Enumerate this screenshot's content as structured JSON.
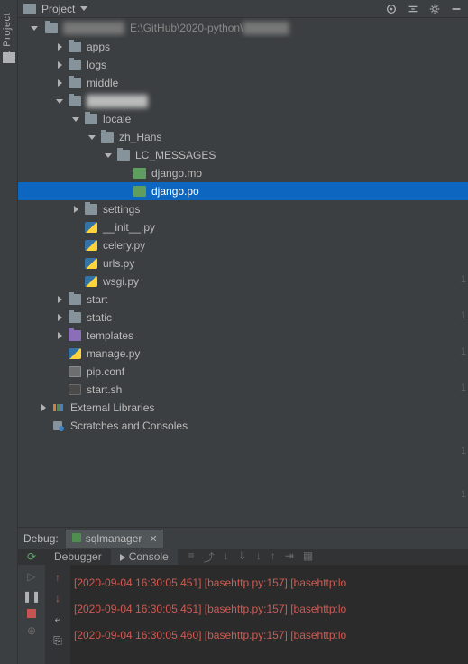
{
  "left_gutter": {
    "label": "1: Project"
  },
  "topbar": {
    "project_label": "Project"
  },
  "path": {
    "text": "E:\\GitHub\\2020-python\\"
  },
  "tree": [
    {
      "indent": 22,
      "chev": "right",
      "icon": "folder",
      "label": "apps"
    },
    {
      "indent": 22,
      "chev": "right",
      "icon": "folder",
      "label": "logs"
    },
    {
      "indent": 22,
      "chev": "right",
      "icon": "folder",
      "label": "middle"
    },
    {
      "indent": 22,
      "chev": "down",
      "icon": "folder",
      "label": "",
      "blur": true
    },
    {
      "indent": 40,
      "chev": "down",
      "icon": "folder",
      "label": "locale"
    },
    {
      "indent": 58,
      "chev": "down",
      "icon": "folder",
      "label": "zh_Hans"
    },
    {
      "indent": 76,
      "chev": "down",
      "icon": "folder",
      "label": "LC_MESSAGES"
    },
    {
      "indent": 94,
      "chev": "none",
      "icon": "po",
      "label": "django.mo"
    },
    {
      "indent": 94,
      "chev": "none",
      "icon": "po",
      "label": "django.po",
      "selected": true
    },
    {
      "indent": 40,
      "chev": "right",
      "icon": "folder",
      "label": "settings"
    },
    {
      "indent": 40,
      "chev": "none",
      "icon": "py",
      "label": "__init__.py"
    },
    {
      "indent": 40,
      "chev": "none",
      "icon": "py",
      "label": "celery.py"
    },
    {
      "indent": 40,
      "chev": "none",
      "icon": "py",
      "label": "urls.py"
    },
    {
      "indent": 40,
      "chev": "none",
      "icon": "py",
      "label": "wsgi.py",
      "gutter": "1"
    },
    {
      "indent": 22,
      "chev": "right",
      "icon": "folder",
      "label": "start"
    },
    {
      "indent": 22,
      "chev": "right",
      "icon": "folder",
      "label": "static",
      "gutter": "1"
    },
    {
      "indent": 22,
      "chev": "right",
      "icon": "folder-purple",
      "label": "templates"
    },
    {
      "indent": 22,
      "chev": "none",
      "icon": "py",
      "label": "manage.py",
      "gutter": "1"
    },
    {
      "indent": 22,
      "chev": "none",
      "icon": "conf",
      "label": "pip.conf"
    },
    {
      "indent": 22,
      "chev": "none",
      "icon": "sh",
      "label": "start.sh",
      "gutter": "1"
    },
    {
      "indent": 4,
      "chev": "right",
      "icon": "ext",
      "label": "External Libraries"
    },
    {
      "indent": 4,
      "chev": "none",
      "icon": "scratch",
      "label": "Scratches and Consoles"
    }
  ],
  "spare_gutters": [
    "1",
    "1"
  ],
  "debug": {
    "label": "Debug:",
    "tab": "sqlmanager"
  },
  "debugger_tabs": {
    "debugger": "Debugger",
    "console": "Console"
  },
  "log_lines": [
    "[2020-09-04 16:30:05,451] [basehttp.py:157] [basehttp:lo",
    "[2020-09-04 16:30:05,451] [basehttp.py:157] [basehttp:lo",
    "[2020-09-04 16:30:05,460] [basehttp.py:157] [basehttp:lo"
  ]
}
